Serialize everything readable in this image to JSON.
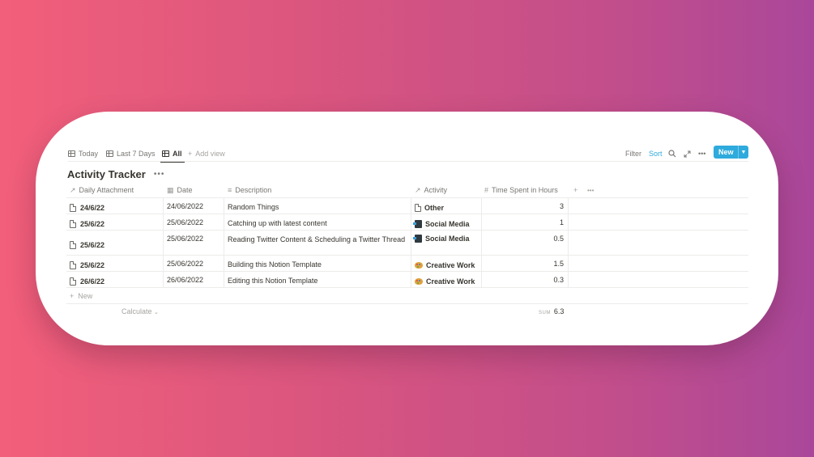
{
  "views": {
    "tabs": [
      {
        "label": "Today",
        "icon": "table-icon"
      },
      {
        "label": "Last 7 Days",
        "icon": "table-icon"
      },
      {
        "label": "All",
        "icon": "table-icon",
        "active": true
      }
    ],
    "add_view_label": "Add view"
  },
  "toolbar": {
    "filter_label": "Filter",
    "sort_label": "Sort",
    "new_label": "New",
    "accent_color": "#2eaadc"
  },
  "database": {
    "title": "Activity Tracker"
  },
  "columns": {
    "daily_attachment": "Daily Attachment",
    "date": "Date",
    "description": "Description",
    "activity": "Activity",
    "time_spent": "Time Spent in Hours"
  },
  "rows": [
    {
      "name": "24/6/22",
      "date": "24/06/2022",
      "description": "Random Things",
      "activity": "Other",
      "activity_icon": "page-icon",
      "hours": "3"
    },
    {
      "name": "25/6/22",
      "date": "25/06/2022",
      "description": "Catching up with latest content",
      "activity": "Social Media",
      "activity_icon": "phone-icon",
      "hours": "1"
    },
    {
      "name": "25/6/22",
      "date": "25/06/2022",
      "description": "Reading Twitter Content & Scheduling a Twitter Thread",
      "activity": "Social Media",
      "activity_icon": "phone-icon",
      "hours": "0.5"
    },
    {
      "name": "25/6/22",
      "date": "25/06/2022",
      "description": "Building this Notion Template",
      "activity": "Creative Work",
      "activity_icon": "palette-icon",
      "hours": "1.5"
    },
    {
      "name": "26/6/22",
      "date": "26/06/2022",
      "description": "Editing this Notion Template",
      "activity": "Creative Work",
      "activity_icon": "palette-icon",
      "hours": "0.3"
    }
  ],
  "footer": {
    "new_row_label": "New",
    "calculate_label": "Calculate",
    "sum_label": "SUM",
    "sum_value": "6.3"
  }
}
